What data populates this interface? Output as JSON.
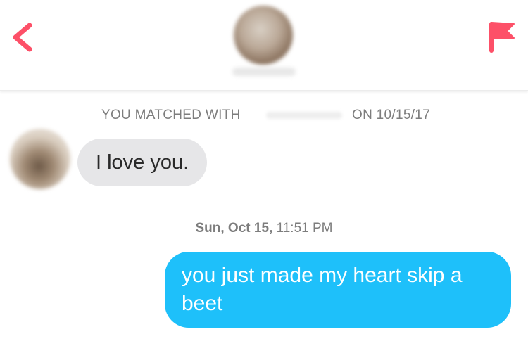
{
  "header": {
    "back_icon": "chevron-left-icon",
    "flag_icon": "flag-icon",
    "accent_color": "#fd5068"
  },
  "match": {
    "prefix": "YOU MATCHED WITH",
    "suffix": "ON 10/15/17"
  },
  "messages": [
    {
      "direction": "received",
      "text": "I love you.",
      "bubble_color": "#e6e6e8"
    },
    {
      "direction": "sent",
      "text": "you just made my heart skip a beet",
      "bubble_color": "#1ec0fa"
    }
  ],
  "timestamp": {
    "day": "Sun, Oct 15,",
    "time": "11:51 PM"
  }
}
